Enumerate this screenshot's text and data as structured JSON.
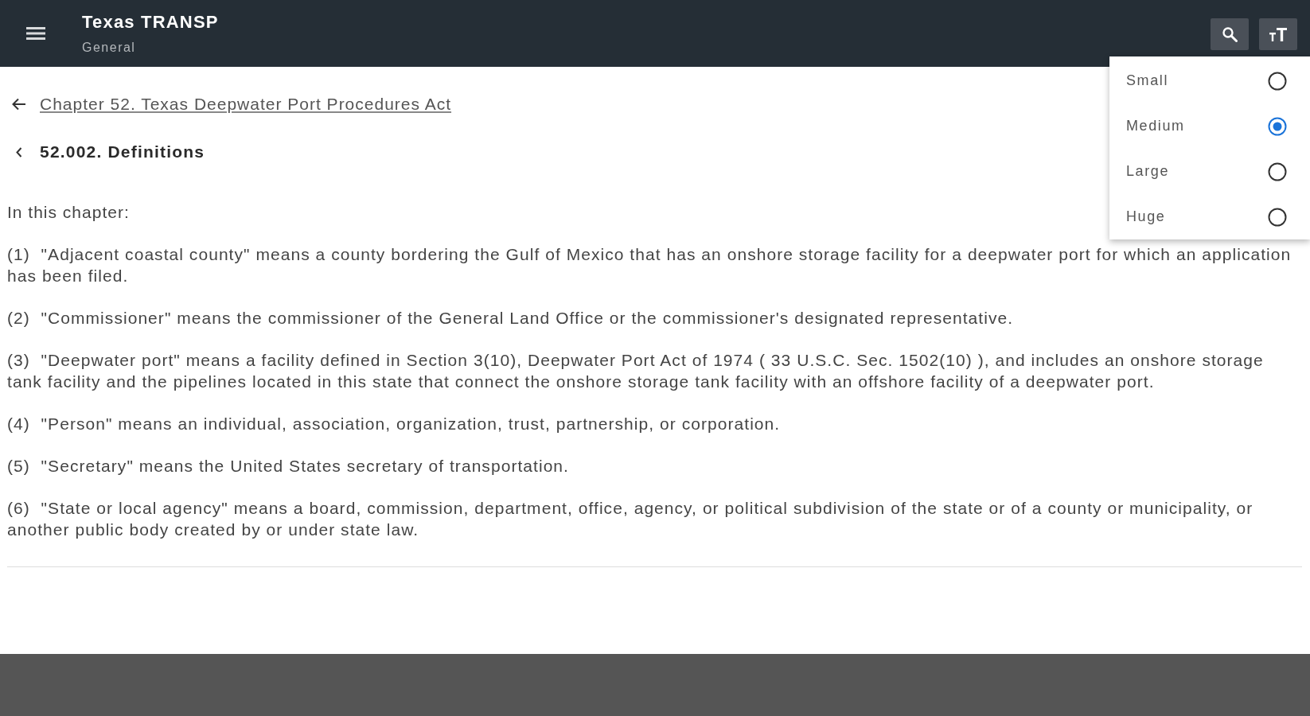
{
  "app_bar": {
    "title": "Texas TRANSP",
    "subtitle": "General"
  },
  "font_size_menu": {
    "items": [
      {
        "label": "Small",
        "selected": false
      },
      {
        "label": "Medium",
        "selected": true
      },
      {
        "label": "Large",
        "selected": false
      },
      {
        "label": "Huge",
        "selected": false
      }
    ]
  },
  "breadcrumb": {
    "link": "Chapter 52. Texas Deepwater Port Procedures Act"
  },
  "section": {
    "title": "52.002. Definitions"
  },
  "content": {
    "intro": "In this chapter:",
    "paragraphs": [
      "(1)  \"Adjacent coastal county\" means a county bordering the Gulf of Mexico that has an onshore storage facility for a deepwater port for which an application has been filed.",
      "(2)  \"Commissioner\" means the commissioner of the General Land Office or the commissioner's designated representative.",
      "(3)  \"Deepwater port\" means a facility defined in Section 3(10), Deepwater Port Act of 1974 ( 33 U.S.C. Sec. 1502(10) ), and includes an onshore storage tank facility and the pipelines located in this state that connect the onshore storage tank facility with an offshore facility of a deepwater port.",
      "(4)  \"Person\" means an individual, association, organization, trust, partnership, or corporation.",
      "(5)  \"Secretary\" means the United States secretary of transportation.",
      "(6)  \"State or local agency\" means a board, commission, department, office, agency, or political subdivision of the state or of a county or municipality, or another public body created by or under state law."
    ]
  }
}
